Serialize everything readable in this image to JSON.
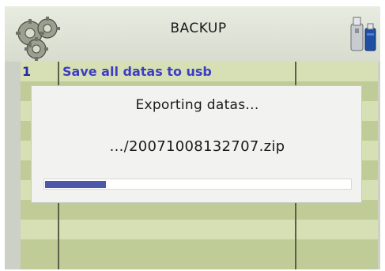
{
  "header": {
    "title": "BACKUP",
    "left_icon": "gears-icon",
    "right_icon": "usb-drive-icon"
  },
  "table": {
    "rows": [
      {
        "number": "1",
        "label": "Save all datas to usb"
      }
    ]
  },
  "dialog": {
    "title": "Exporting datas...",
    "filename": ".../20071008132707.zip",
    "progress_fraction": 0.2
  },
  "colors": {
    "row_text": "#3d3dc4",
    "progress_fill": "#4d58aa",
    "table_row_light": "#d6e0b4",
    "table_row_dark": "#bfcc98"
  }
}
